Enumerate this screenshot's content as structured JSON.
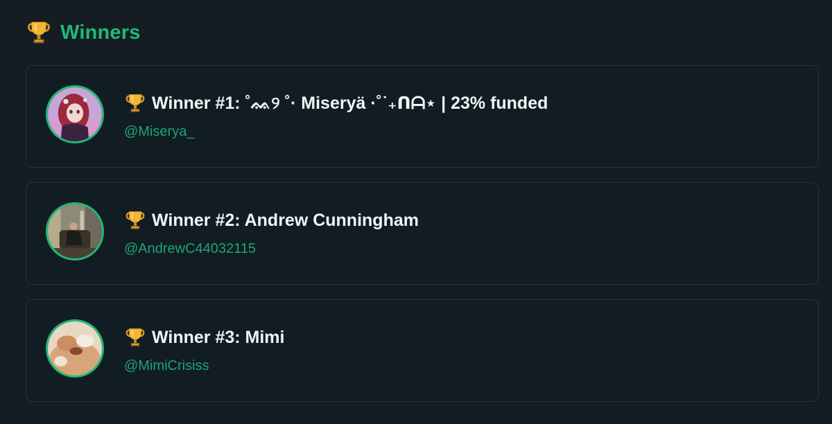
{
  "section": {
    "title": "Winners",
    "icon": "trophy-icon"
  },
  "colors": {
    "background": "#151d22",
    "card": "#111d23",
    "accent": "#20b97a",
    "handle": "#20a373",
    "text": "#f2f4f5"
  },
  "winners": [
    {
      "title": "Winner #1: ˚ᨐ୨ ˚· Miseryä ·˚˙₊ᑎᗩ⋆ | 23% funded",
      "handle": "@Miserya_",
      "avatar": "anime-girl-avatar"
    },
    {
      "title": "Winner #2: Andrew Cunningham",
      "handle": "@AndrewC44032115",
      "avatar": "man-in-chair-avatar"
    },
    {
      "title": "Winner #3: Mimi",
      "handle": "@MimiCrisiss",
      "avatar": "cat-avatar"
    }
  ]
}
